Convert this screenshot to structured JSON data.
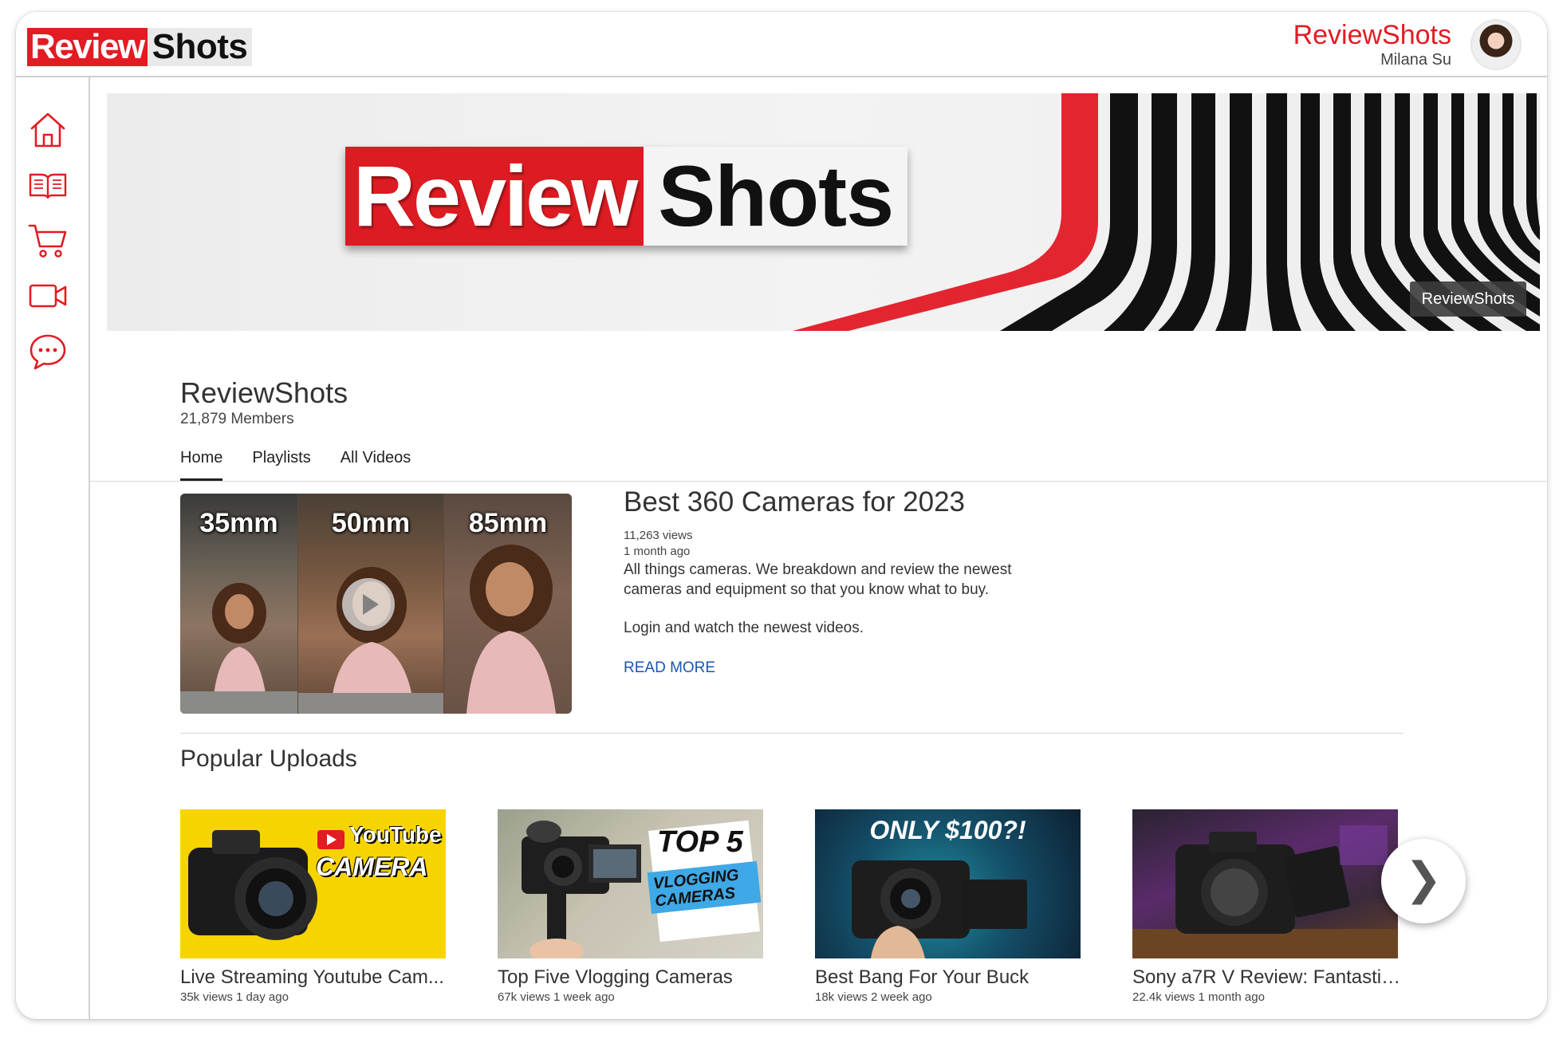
{
  "header": {
    "logo_left": "Review",
    "logo_right": "Shots",
    "account_title": "ReviewShots",
    "account_user": "Milana Su"
  },
  "sidebar": {
    "items": [
      {
        "icon": "home-icon"
      },
      {
        "icon": "book-icon"
      },
      {
        "icon": "cart-icon"
      },
      {
        "icon": "video-camera-icon"
      },
      {
        "icon": "chat-icon"
      }
    ]
  },
  "banner": {
    "logo_left": "Review",
    "logo_right": "Shots",
    "tag": "ReviewShots"
  },
  "channel": {
    "name": "ReviewShots",
    "members": "21,879 Members"
  },
  "tabs": [
    {
      "label": "Home",
      "active": true
    },
    {
      "label": "Playlists",
      "active": false
    },
    {
      "label": "All Videos",
      "active": false
    }
  ],
  "featured": {
    "thumb_labels": [
      "35mm",
      "50mm",
      "85mm"
    ],
    "title": "Best 360 Cameras for 2023",
    "views": "11,263 views",
    "time": "1 month ago",
    "description": "All things cameras. We breakdown and review the newest cameras and equipment so that you know what to buy.",
    "login_text": "Login and watch the newest videos.",
    "read_more": "READ MORE"
  },
  "popular": {
    "title": "Popular Uploads",
    "next_label": "❯",
    "items": [
      {
        "title": "Live Streaming Youtube Cam...",
        "meta": "35k views  1 day ago",
        "thumb_text_1": "YouTube",
        "thumb_text_2": "CAMERA"
      },
      {
        "title": "Top Five Vlogging Cameras",
        "meta": "67k views  1 week ago",
        "thumb_text_1": "TOP 5",
        "thumb_text_2": "VLOGGING CAMERAS"
      },
      {
        "title": "Best Bang For Your Buck",
        "meta": "18k views  2 week ago",
        "thumb_text_1": "ONLY $100?!",
        "thumb_text_2": ""
      },
      {
        "title": "Sony a7R V Review: Fantastic...",
        "meta": "22.4k views  1 month ago",
        "thumb_text_1": "",
        "thumb_text_2": ""
      }
    ]
  },
  "colors": {
    "brand_red": "#e31b23",
    "link_blue": "#1a56b0"
  }
}
